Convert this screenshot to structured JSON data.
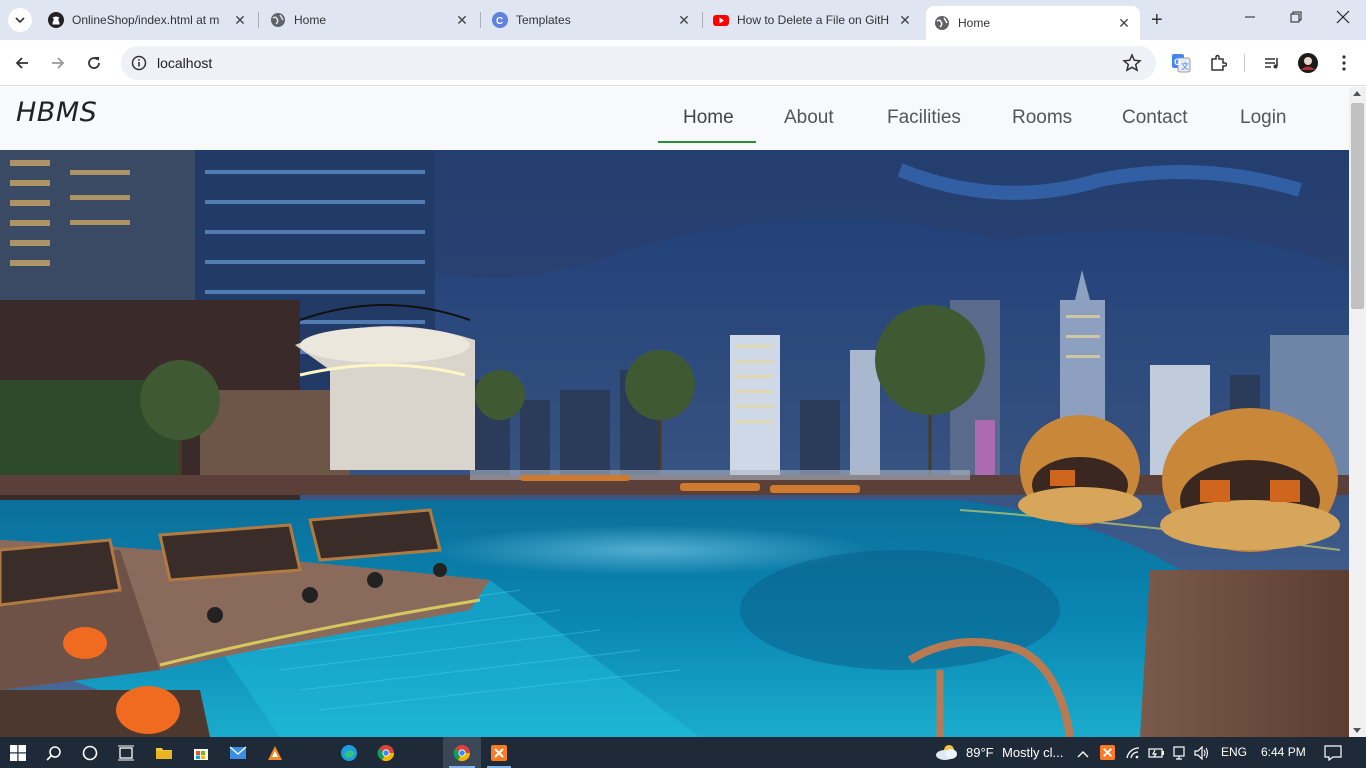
{
  "browser": {
    "tabs": [
      {
        "title": "OnlineShop/index.html at m",
        "favicon": "github-icon"
      },
      {
        "title": "Home",
        "favicon": "globe-icon"
      },
      {
        "title": "Templates",
        "favicon": "canva-icon"
      },
      {
        "title": "How to Delete a File on GitH",
        "favicon": "youtube-icon"
      },
      {
        "title": "Home",
        "favicon": "globe-icon",
        "active": true
      }
    ],
    "address": "localhost"
  },
  "site": {
    "brand": "HBMS",
    "nav": [
      "Home",
      "About",
      "Facilities",
      "Rooms",
      "Contact",
      "Login"
    ],
    "active_nav": "Home",
    "accent_color": "#2e8b3a",
    "hero_alt": "Rooftop hotel pool at night with city skyline"
  },
  "taskbar": {
    "weather": {
      "temp": "89°F",
      "condition": "Mostly cl..."
    },
    "language": "ENG",
    "time": "6:44 PM"
  }
}
